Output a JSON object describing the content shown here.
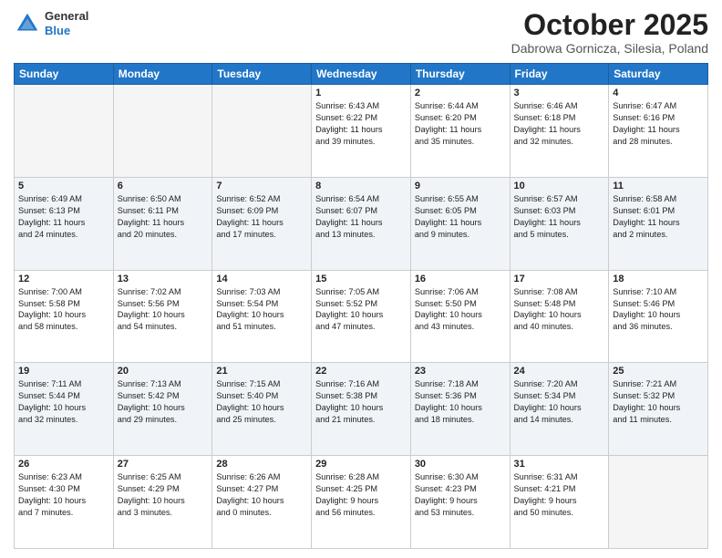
{
  "header": {
    "logo": {
      "general": "General",
      "blue": "Blue"
    },
    "title": "October 2025",
    "location": "Dabrowa Gornicza, Silesia, Poland"
  },
  "days_of_week": [
    "Sunday",
    "Monday",
    "Tuesday",
    "Wednesday",
    "Thursday",
    "Friday",
    "Saturday"
  ],
  "weeks": [
    {
      "shade": false,
      "days": [
        {
          "num": "",
          "info": ""
        },
        {
          "num": "",
          "info": ""
        },
        {
          "num": "",
          "info": ""
        },
        {
          "num": "1",
          "info": "Sunrise: 6:43 AM\nSunset: 6:22 PM\nDaylight: 11 hours\nand 39 minutes."
        },
        {
          "num": "2",
          "info": "Sunrise: 6:44 AM\nSunset: 6:20 PM\nDaylight: 11 hours\nand 35 minutes."
        },
        {
          "num": "3",
          "info": "Sunrise: 6:46 AM\nSunset: 6:18 PM\nDaylight: 11 hours\nand 32 minutes."
        },
        {
          "num": "4",
          "info": "Sunrise: 6:47 AM\nSunset: 6:16 PM\nDaylight: 11 hours\nand 28 minutes."
        }
      ]
    },
    {
      "shade": true,
      "days": [
        {
          "num": "5",
          "info": "Sunrise: 6:49 AM\nSunset: 6:13 PM\nDaylight: 11 hours\nand 24 minutes."
        },
        {
          "num": "6",
          "info": "Sunrise: 6:50 AM\nSunset: 6:11 PM\nDaylight: 11 hours\nand 20 minutes."
        },
        {
          "num": "7",
          "info": "Sunrise: 6:52 AM\nSunset: 6:09 PM\nDaylight: 11 hours\nand 17 minutes."
        },
        {
          "num": "8",
          "info": "Sunrise: 6:54 AM\nSunset: 6:07 PM\nDaylight: 11 hours\nand 13 minutes."
        },
        {
          "num": "9",
          "info": "Sunrise: 6:55 AM\nSunset: 6:05 PM\nDaylight: 11 hours\nand 9 minutes."
        },
        {
          "num": "10",
          "info": "Sunrise: 6:57 AM\nSunset: 6:03 PM\nDaylight: 11 hours\nand 5 minutes."
        },
        {
          "num": "11",
          "info": "Sunrise: 6:58 AM\nSunset: 6:01 PM\nDaylight: 11 hours\nand 2 minutes."
        }
      ]
    },
    {
      "shade": false,
      "days": [
        {
          "num": "12",
          "info": "Sunrise: 7:00 AM\nSunset: 5:58 PM\nDaylight: 10 hours\nand 58 minutes."
        },
        {
          "num": "13",
          "info": "Sunrise: 7:02 AM\nSunset: 5:56 PM\nDaylight: 10 hours\nand 54 minutes."
        },
        {
          "num": "14",
          "info": "Sunrise: 7:03 AM\nSunset: 5:54 PM\nDaylight: 10 hours\nand 51 minutes."
        },
        {
          "num": "15",
          "info": "Sunrise: 7:05 AM\nSunset: 5:52 PM\nDaylight: 10 hours\nand 47 minutes."
        },
        {
          "num": "16",
          "info": "Sunrise: 7:06 AM\nSunset: 5:50 PM\nDaylight: 10 hours\nand 43 minutes."
        },
        {
          "num": "17",
          "info": "Sunrise: 7:08 AM\nSunset: 5:48 PM\nDaylight: 10 hours\nand 40 minutes."
        },
        {
          "num": "18",
          "info": "Sunrise: 7:10 AM\nSunset: 5:46 PM\nDaylight: 10 hours\nand 36 minutes."
        }
      ]
    },
    {
      "shade": true,
      "days": [
        {
          "num": "19",
          "info": "Sunrise: 7:11 AM\nSunset: 5:44 PM\nDaylight: 10 hours\nand 32 minutes."
        },
        {
          "num": "20",
          "info": "Sunrise: 7:13 AM\nSunset: 5:42 PM\nDaylight: 10 hours\nand 29 minutes."
        },
        {
          "num": "21",
          "info": "Sunrise: 7:15 AM\nSunset: 5:40 PM\nDaylight: 10 hours\nand 25 minutes."
        },
        {
          "num": "22",
          "info": "Sunrise: 7:16 AM\nSunset: 5:38 PM\nDaylight: 10 hours\nand 21 minutes."
        },
        {
          "num": "23",
          "info": "Sunrise: 7:18 AM\nSunset: 5:36 PM\nDaylight: 10 hours\nand 18 minutes."
        },
        {
          "num": "24",
          "info": "Sunrise: 7:20 AM\nSunset: 5:34 PM\nDaylight: 10 hours\nand 14 minutes."
        },
        {
          "num": "25",
          "info": "Sunrise: 7:21 AM\nSunset: 5:32 PM\nDaylight: 10 hours\nand 11 minutes."
        }
      ]
    },
    {
      "shade": false,
      "days": [
        {
          "num": "26",
          "info": "Sunrise: 6:23 AM\nSunset: 4:30 PM\nDaylight: 10 hours\nand 7 minutes."
        },
        {
          "num": "27",
          "info": "Sunrise: 6:25 AM\nSunset: 4:29 PM\nDaylight: 10 hours\nand 3 minutes."
        },
        {
          "num": "28",
          "info": "Sunrise: 6:26 AM\nSunset: 4:27 PM\nDaylight: 10 hours\nand 0 minutes."
        },
        {
          "num": "29",
          "info": "Sunrise: 6:28 AM\nSunset: 4:25 PM\nDaylight: 9 hours\nand 56 minutes."
        },
        {
          "num": "30",
          "info": "Sunrise: 6:30 AM\nSunset: 4:23 PM\nDaylight: 9 hours\nand 53 minutes."
        },
        {
          "num": "31",
          "info": "Sunrise: 6:31 AM\nSunset: 4:21 PM\nDaylight: 9 hours\nand 50 minutes."
        },
        {
          "num": "",
          "info": ""
        }
      ]
    }
  ]
}
